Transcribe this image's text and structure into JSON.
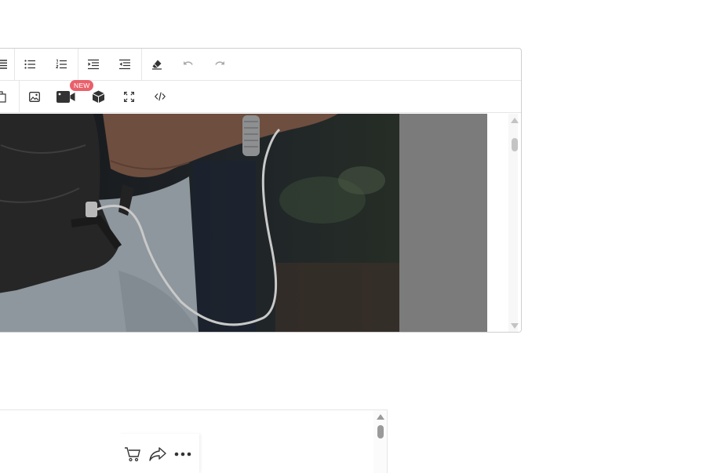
{
  "editor": {
    "toolbar_row1": {
      "buttons": [
        {
          "name": "align-justify",
          "disabled": false
        },
        {
          "name": "bulleted-list",
          "disabled": false
        },
        {
          "name": "numbered-list",
          "disabled": false
        },
        {
          "name": "indent",
          "disabled": false
        },
        {
          "name": "outdent",
          "disabled": false
        },
        {
          "name": "clear-formatting",
          "disabled": false
        },
        {
          "name": "undo",
          "disabled": true
        },
        {
          "name": "redo",
          "disabled": true
        }
      ]
    },
    "toolbar_row2": {
      "buttons": [
        {
          "name": "paste"
        },
        {
          "name": "insert-image"
        },
        {
          "name": "insert-video"
        },
        {
          "name": "insert-3d-model"
        },
        {
          "name": "fullscreen"
        },
        {
          "name": "source-code"
        }
      ],
      "new_badge": "NEW"
    },
    "content": {
      "image_subject": "person-with-backpack-and-charging-cable",
      "colors": {
        "side_pane": "#7b7b7b",
        "photo_dark": "#1d1f22"
      }
    }
  },
  "preview_panel": {
    "actions": [
      {
        "name": "cart"
      },
      {
        "name": "share"
      },
      {
        "name": "more"
      }
    ]
  },
  "colors": {
    "accent_badge": "#e9606b",
    "border": "#cfcfcf"
  }
}
